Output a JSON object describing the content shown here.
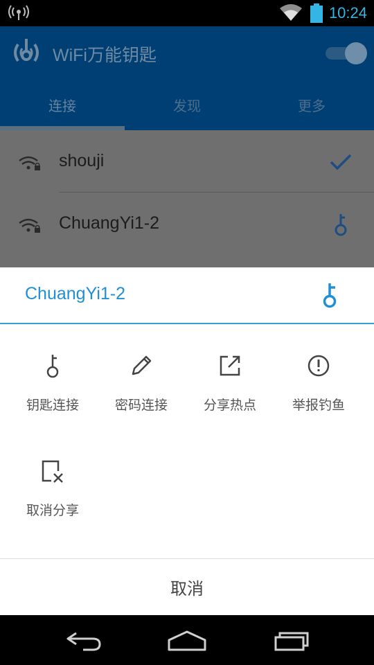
{
  "status_bar": {
    "time": "10:24"
  },
  "app_bar": {
    "title": "WiFi万能钥匙",
    "tabs": [
      {
        "label": "连接",
        "active": true
      },
      {
        "label": "发现",
        "active": false
      },
      {
        "label": "更多",
        "active": false
      }
    ]
  },
  "wifi_list": [
    {
      "ssid": "shouji",
      "status": "connected",
      "action_icon": "check-icon"
    },
    {
      "ssid": "ChuangYi1-2",
      "status": "key-available",
      "action_icon": "key-icon"
    }
  ],
  "sheet": {
    "title": "ChuangYi1-2",
    "actions": [
      {
        "label": "钥匙连接",
        "icon": "key-icon"
      },
      {
        "label": "密码连接",
        "icon": "pencil-icon"
      },
      {
        "label": "分享热点",
        "icon": "share-icon"
      },
      {
        "label": "举报钓鱼",
        "icon": "alert-icon"
      },
      {
        "label": "取消分享",
        "icon": "unshare-icon"
      }
    ],
    "cancel_label": "取消"
  },
  "colors": {
    "accent": "#1f8fd6",
    "app_bar": "#003f73",
    "dim_overlay_list": "#6f6f6f"
  }
}
